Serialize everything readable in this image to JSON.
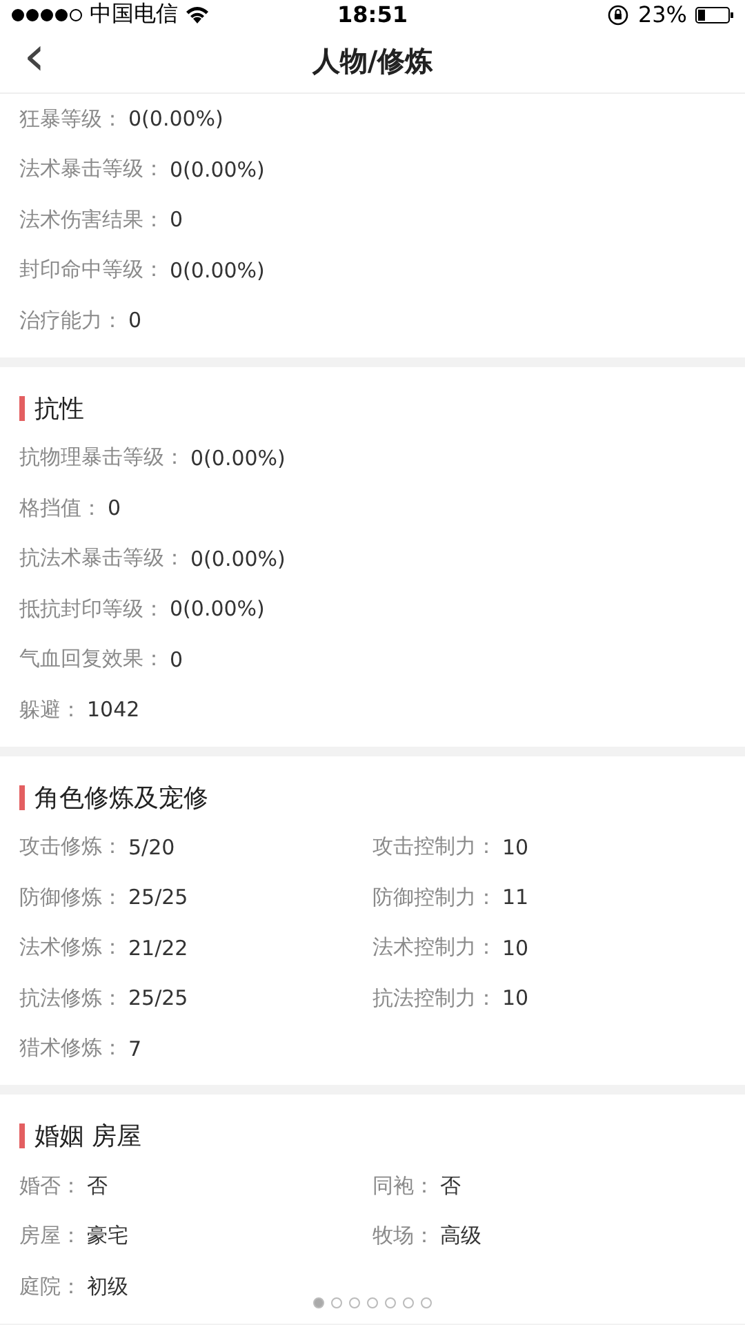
{
  "status_bar": {
    "carrier": "中国电信",
    "time": "18:51",
    "battery": "23%"
  },
  "nav": {
    "back": "‹",
    "title": "人物/修炼"
  },
  "sections": [
    {
      "kind": "single",
      "items": [
        {
          "label": "狂暴等级：",
          "value": "0(0.00%)"
        },
        {
          "label": "法术暴击等级：",
          "value": "0(0.00%)"
        },
        {
          "label": "法术伤害结果：",
          "value": "0"
        },
        {
          "label": "封印命中等级：",
          "value": "0(0.00%)"
        },
        {
          "label": "治疗能力：",
          "value": "0"
        }
      ]
    },
    {
      "title": "抗性",
      "kind": "single",
      "items": [
        {
          "label": "抗物理暴击等级：",
          "value": "0(0.00%)"
        },
        {
          "label": "格挡值：",
          "value": "0"
        },
        {
          "label": "抗法术暴击等级：",
          "value": "0(0.00%)"
        },
        {
          "label": "抵抗封印等级：",
          "value": "0(0.00%)"
        },
        {
          "label": "气血回复效果：",
          "value": "0"
        },
        {
          "label": "躲避：",
          "value": "1042"
        }
      ]
    },
    {
      "title": "角色修炼及宠修",
      "kind": "double",
      "items": [
        {
          "label": "攻击修炼：",
          "value": "5/20"
        },
        {
          "label": "攻击控制力：",
          "value": "10"
        },
        {
          "label": "防御修炼：",
          "value": "25/25"
        },
        {
          "label": "防御控制力：",
          "value": "11"
        },
        {
          "label": "法术修炼：",
          "value": "21/22"
        },
        {
          "label": "法术控制力：",
          "value": "10"
        },
        {
          "label": "抗法修炼：",
          "value": "25/25"
        },
        {
          "label": "抗法控制力：",
          "value": "10"
        },
        {
          "label": "猎术修炼：",
          "value": "7"
        }
      ]
    },
    {
      "title": "婚姻 房屋",
      "kind": "double",
      "items": [
        {
          "label": "婚否：",
          "value": "否"
        },
        {
          "label": "同袍：",
          "value": "否"
        },
        {
          "label": "房屋：",
          "value": "豪宅"
        },
        {
          "label": "牧场：",
          "value": "高级"
        },
        {
          "label": "庭院：",
          "value": "初级"
        }
      ]
    }
  ],
  "pager": [
    {
      "selected": true
    },
    {
      "selected": false
    },
    {
      "selected": false
    },
    {
      "selected": false
    },
    {
      "selected": false
    },
    {
      "selected": false
    },
    {
      "selected": false
    }
  ]
}
